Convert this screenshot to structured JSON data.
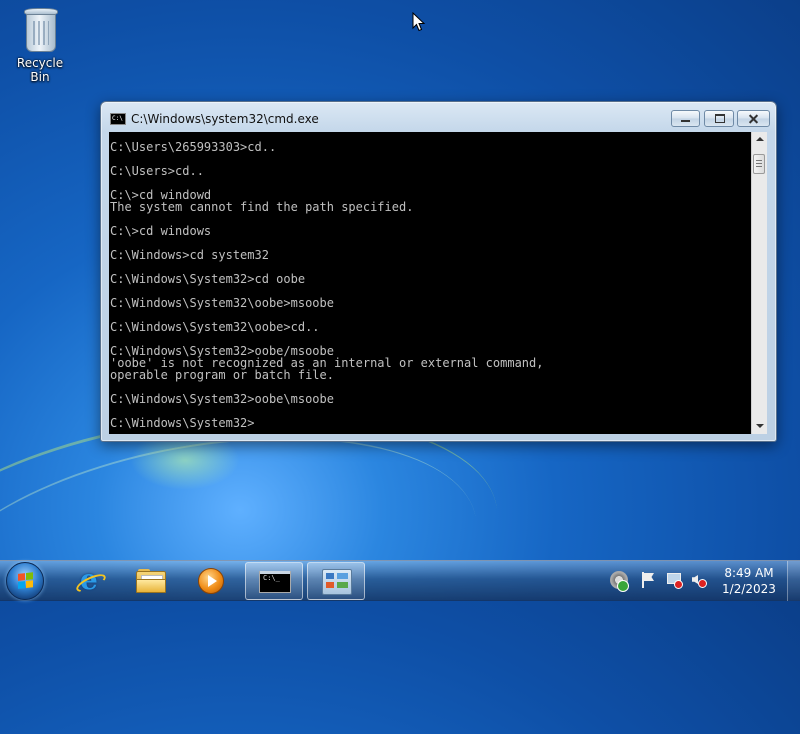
{
  "desktop": {
    "icons": [
      {
        "label": "Recycle Bin",
        "icon": "recycle-bin-icon"
      }
    ]
  },
  "window": {
    "title": "C:\\Windows\\system32\\cmd.exe",
    "icon": "cmd-icon",
    "controls": [
      "minimize",
      "maximize",
      "close"
    ]
  },
  "console": {
    "background": "#000000",
    "foreground": "#c0c0c0",
    "lines": [
      "C:\\Users\\265993303>cd..",
      "",
      "C:\\Users>cd..",
      "",
      "C:\\>cd windowd",
      "The system cannot find the path specified.",
      "",
      "C:\\>cd windows",
      "",
      "C:\\Windows>cd system32",
      "",
      "C:\\Windows\\System32>cd oobe",
      "",
      "C:\\Windows\\System32\\oobe>msoobe",
      "",
      "C:\\Windows\\System32\\oobe>cd..",
      "",
      "C:\\Windows\\System32>oobe/msoobe",
      "'oobe' is not recognized as an internal or external command,",
      "operable program or batch file.",
      "",
      "C:\\Windows\\System32>oobe\\msoobe",
      "",
      "C:\\Windows\\System32>"
    ]
  },
  "taskbar": {
    "start": "windows-start-icon",
    "pinned": [
      {
        "name": "internet-explorer",
        "icon": "internet-explorer-icon"
      },
      {
        "name": "windows-explorer",
        "icon": "folder-icon"
      },
      {
        "name": "windows-media-player",
        "icon": "media-player-icon"
      },
      {
        "name": "command-prompt",
        "icon": "cmd-icon",
        "active": true
      },
      {
        "name": "control-panel",
        "icon": "control-panel-icon"
      }
    ],
    "tray_icons": [
      "action-center-flag-icon",
      "security-icon",
      "network-icon",
      "volume-icon"
    ],
    "clock": {
      "time": "8:49 AM",
      "date": "1/2/2023"
    }
  }
}
